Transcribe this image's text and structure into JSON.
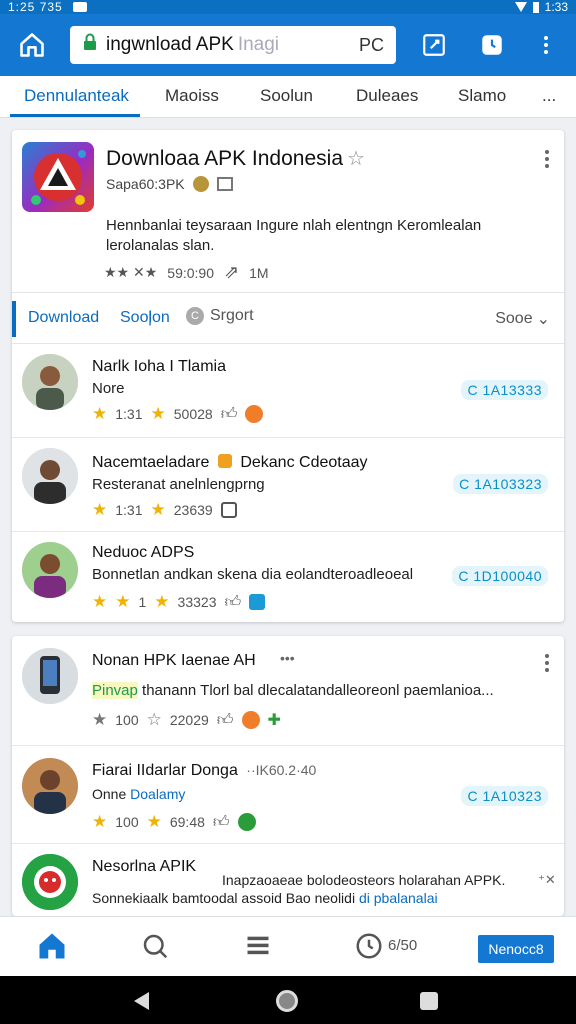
{
  "status_bar": {
    "time": "1:25 735",
    "clock_right": "1:33"
  },
  "browser": {
    "url": "ingwnload APK",
    "url_ghost": "Inagi",
    "url_right_label": "PC",
    "icons": [
      "home-icon",
      "lock-icon",
      "edit-icon",
      "tab-icon",
      "more-vert-icon"
    ]
  },
  "tabs": [
    "Dennulanteak",
    "Maoiss",
    "Soolun",
    "Duleaes",
    "Slamo",
    "..."
  ],
  "app": {
    "title": "Downloaa APK Indonesia",
    "meta": "Sapa60:3PK",
    "description": "Hennbanlai teysaraan Ingure nlah elentngn Keromlealan lerolanalas slan.",
    "rating": "★★ ✕★",
    "downloads": "59:0:90",
    "size": "1M"
  },
  "filter": {
    "primary": "Download",
    "separator": "|",
    "secondary": "Soolon",
    "report": "Srgort",
    "sort": "Sooe"
  },
  "reviews": [
    {
      "name": "Narlk Ioha I Tlamia",
      "text": "Nore",
      "rating": "1:31",
      "count": "50028",
      "badge": "C 1A13333"
    },
    {
      "name": "Nacemtaeladare",
      "name_suffix": "Dekanc Cdeotaay",
      "text": "Resteranat anelnlengprng",
      "rating": "1:31",
      "count": "23639",
      "badge": "C 1A103323"
    },
    {
      "name": "Neduoc ADPS",
      "text": "Bonnetlan andkan skena dia eolandteroadleoeal",
      "rating": "1",
      "count": "33323",
      "badge": "C 1D100040"
    }
  ],
  "section2": {
    "title": "Nonan HPK Iaenae AH",
    "more": "•••",
    "posts": [
      {
        "name": "",
        "prefix": "Pinvap",
        "text": "thanann Tlorl bal dlecalatandalleoreonl paemlanioa...",
        "rating": "100",
        "count": "22029"
      },
      {
        "name": "Fiarai IIdarlar Donga",
        "meta": "··IK60.2·40",
        "text_prefix": "Onne",
        "text": "Doalamy",
        "rating": "100",
        "count": "69:48",
        "badge": "C 1A10323"
      },
      {
        "name": "Nesorlna APIK",
        "snippet": "Inapzaoaeae bolodeosteors holarahan APPK.",
        "text": "Sonnekiaalk bamtoodal assoid Bao neolidi",
        "text_link": "di pbalanalai"
      }
    ]
  },
  "bottom_nav": {
    "count": "6/50",
    "action": "Nenocc8"
  },
  "colors": {
    "primary": "#1478d2",
    "accent_text": "#0a6cc0",
    "star": "#f0b400",
    "badge_bg": "#e3f4fb"
  }
}
